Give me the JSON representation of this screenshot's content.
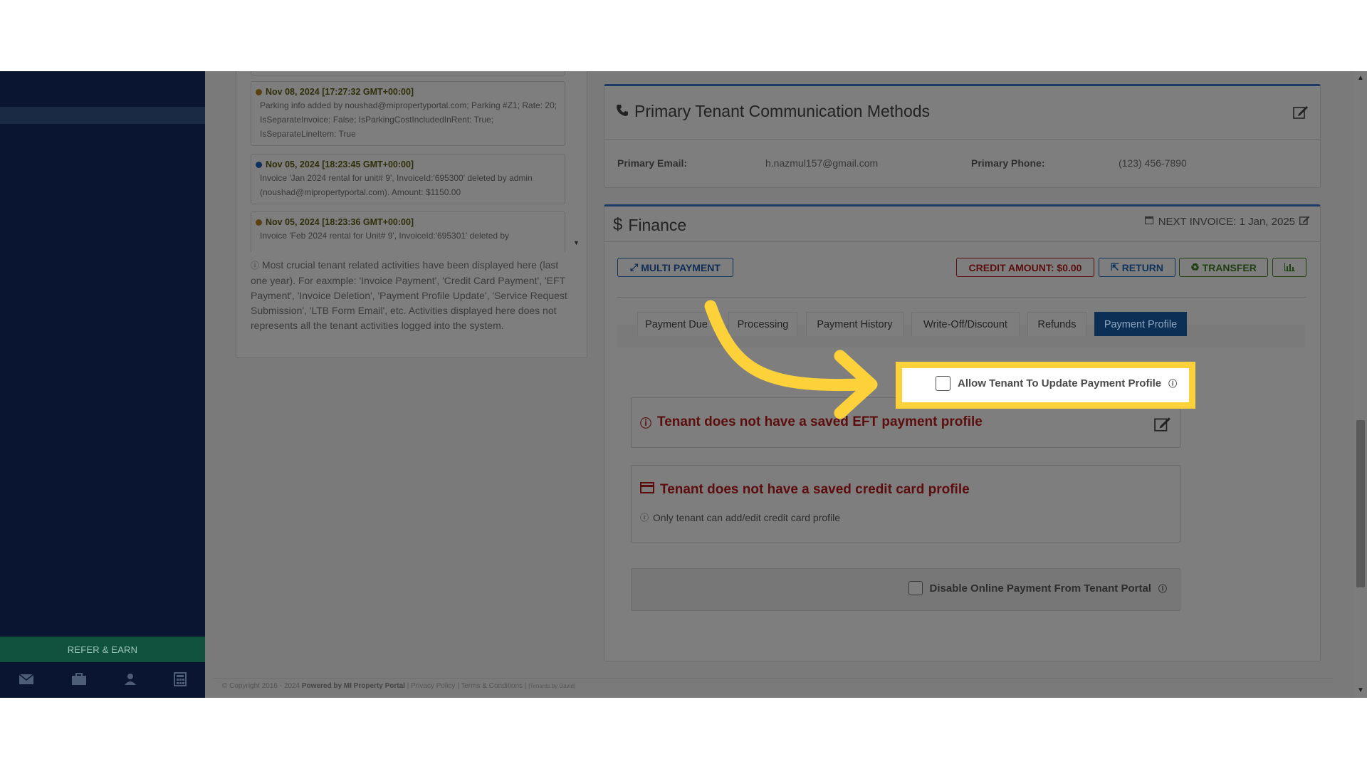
{
  "sidebar": {
    "refer_label": "REFER & EARN",
    "icons": [
      "envelope-icon",
      "briefcase-icon",
      "user-icon",
      "calculator-icon"
    ]
  },
  "activity": {
    "items": [
      {
        "time": "Nov 08, 2024 [17:27:32 GMT+00:00]",
        "dot_color": "#5b4010",
        "text": "Parking info added by noushad@mipropertyportal.com; Parking #Z1; Rate: 20; IsSeparateInvoice: False; IsParkingCostIncludedInRent: True; IsSeparateLineItem: True"
      },
      {
        "time": "Nov 05, 2024 [18:23:45 GMT+00:00]",
        "dot_color": "#0f2f5c",
        "text": "Invoice 'Jan 2024 rental for unit# 9', InvoiceId:'695300' deleted by admin (noushad@mipropertyportal.com). Amount: $1150.00"
      },
      {
        "time": "Nov 05, 2024 [18:23:36 GMT+00:00]",
        "dot_color": "#5b4010",
        "text": "Invoice 'Feb 2024 rental for Unit# 9', InvoiceId:'695301' deleted by"
      }
    ],
    "note": "Most crucial tenant related activities have been displayed here (last one year). For eaxmple: 'Invoice Payment', 'Credit Card Payment', 'EFT Payment', 'Invoice Deletion', 'Payment Profile Update', 'Service Request Submission', 'LTB Form Email', etc. Activities displayed here does not represents all the tenant activities logged into the system."
  },
  "communication": {
    "title": "Primary Tenant Communication Methods",
    "email_label": "Primary Email:",
    "email_value": "h.nazmul157@gmail.com",
    "phone_label": "Primary Phone:",
    "phone_value": "(123) 456-7890"
  },
  "finance": {
    "title": "Finance",
    "next_invoice": "NEXT INVOICE: 1 Jan, 2025",
    "buttons": {
      "multi_payment": "MULTI PAYMENT",
      "credit_amount": "CREDIT AMOUNT: $0.00",
      "return": "RETURN",
      "transfer": "TRANSFER"
    },
    "tabs": [
      "Payment Due",
      "Processing",
      "Payment History",
      "Write-Off/Discount",
      "Refunds",
      "Payment Profile"
    ],
    "allow_update_label": "Allow Tenant To Update Payment Profile",
    "eft_msg": "Tenant does not have a saved EFT payment profile",
    "cc_msg": "Tenant does not have a saved credit card profile",
    "cc_note": "Only tenant can add/edit credit card profile",
    "disable_online_label": "Disable Online Payment From Tenant Portal"
  },
  "footer": {
    "copyright": "© Copyright 2016 - 2024",
    "powered": "Powered by MI Property Portal",
    "privacy": "Privacy Policy",
    "terms": "Terms & Conditions",
    "tenants_by": "[Tenants by David]"
  },
  "colors": {
    "highlight": "#fcd13a",
    "active_tab": "#0c2f55",
    "danger_text": "#5c0d0d"
  }
}
